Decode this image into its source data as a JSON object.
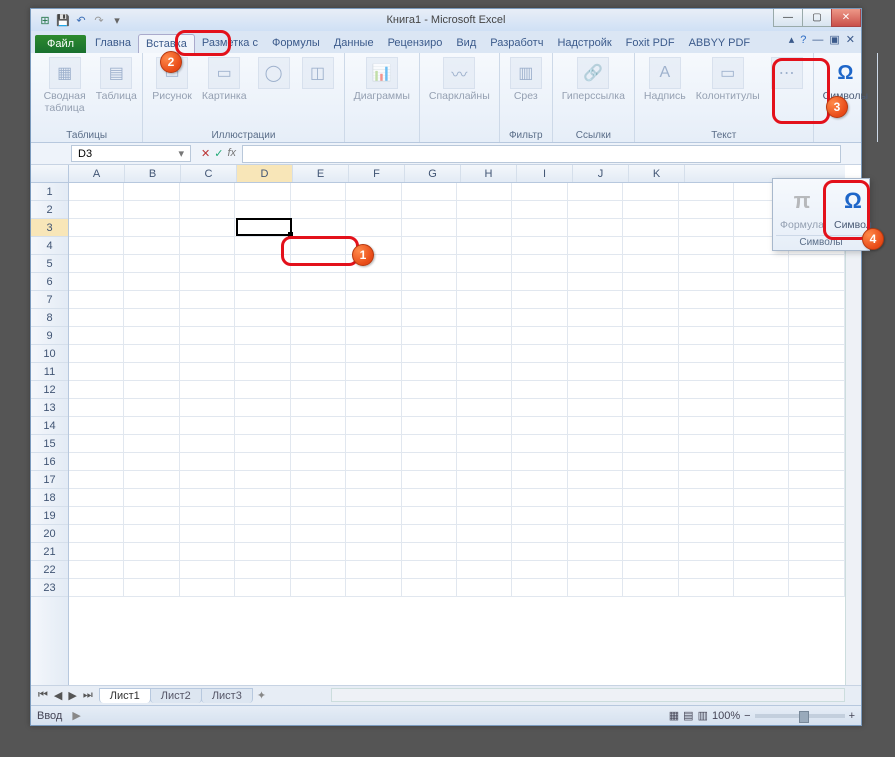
{
  "title": "Книга1  -  Microsoft Excel",
  "tabs": {
    "file": "Файл",
    "items": [
      "Главна",
      "Вставка",
      "Разметка с",
      "Формулы",
      "Данные",
      "Рецензиро",
      "Вид",
      "Разработч",
      "Надстройк",
      "Foxit PDF",
      "ABBYY PDF"
    ],
    "active_index": 1
  },
  "ribbon": {
    "groups": [
      {
        "label": "Таблицы",
        "buttons": [
          {
            "name": "pivot",
            "label": "Сводная\nтаблица",
            "icon": "▦"
          },
          {
            "name": "table",
            "label": "Таблица",
            "icon": "▤"
          }
        ]
      },
      {
        "label": "Иллюстрации",
        "buttons": [
          {
            "name": "pic",
            "label": "Рисунок",
            "icon": "▭"
          },
          {
            "name": "img",
            "label": "Картинка",
            "icon": "▭"
          },
          {
            "name": "shapes",
            "label": "",
            "icon": "◯"
          },
          {
            "name": "smart",
            "label": "",
            "icon": "◫"
          }
        ]
      },
      {
        "label": "",
        "buttons": [
          {
            "name": "charts",
            "label": "Диаграммы",
            "icon": "📊"
          }
        ]
      },
      {
        "label": "",
        "buttons": [
          {
            "name": "spark",
            "label": "Спарклайны",
            "icon": "〰"
          }
        ]
      },
      {
        "label": "Фильтр",
        "buttons": [
          {
            "name": "slicer",
            "label": "Срез",
            "icon": "▥"
          }
        ]
      },
      {
        "label": "Ссылки",
        "buttons": [
          {
            "name": "link",
            "label": "Гиперссылка",
            "icon": "🔗"
          }
        ]
      },
      {
        "label": "Текст",
        "buttons": [
          {
            "name": "textbox",
            "label": "Надпись",
            "icon": "A"
          },
          {
            "name": "headerfooter",
            "label": "Колонтитулы",
            "icon": "▭"
          },
          {
            "name": "more",
            "label": "",
            "icon": "⋯"
          }
        ]
      },
      {
        "label": "",
        "buttons": [
          {
            "name": "symbols",
            "label": "Символы",
            "icon": "Ω"
          }
        ]
      }
    ]
  },
  "dropdown": {
    "buttons": [
      {
        "name": "equation",
        "label": "Формула",
        "icon": "π",
        "color": "#888"
      },
      {
        "name": "symbol",
        "label": "Символ",
        "icon": "Ω",
        "color": "#1e66c9"
      }
    ],
    "group_label": "Символы"
  },
  "namebox": "D3",
  "columns": [
    "A",
    "B",
    "C",
    "D",
    "E",
    "F",
    "G",
    "H",
    "I",
    "J",
    "K"
  ],
  "rows_count": 23,
  "active": {
    "col": 3,
    "row": 2
  },
  "sheets": [
    "Лист1",
    "Лист2",
    "Лист3"
  ],
  "active_sheet": 0,
  "status": "Ввод",
  "zoom": "100%",
  "callouts": {
    "1": "1",
    "2": "2",
    "3": "3",
    "4": "4"
  }
}
